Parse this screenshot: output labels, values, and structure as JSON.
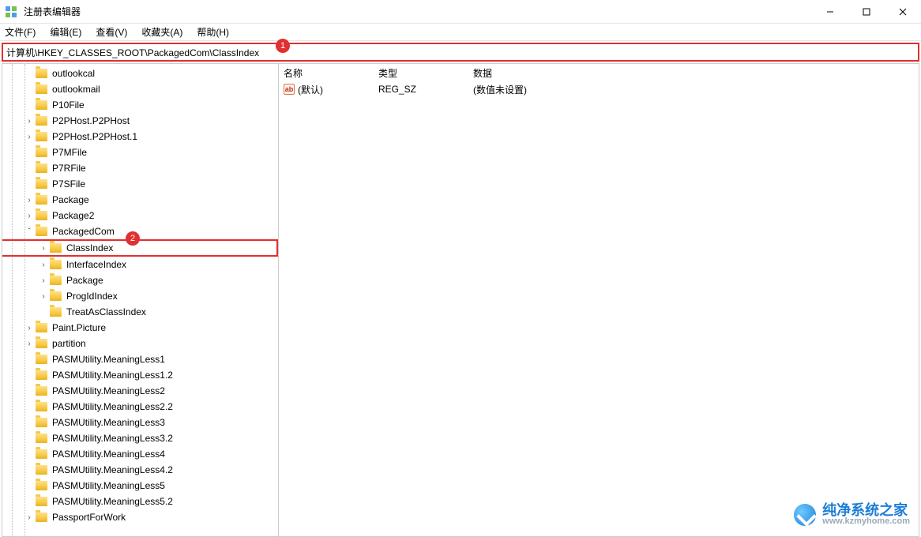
{
  "title": "注册表编辑器",
  "menu": {
    "file": "文件(F)",
    "edit": "编辑(E)",
    "view": "查看(V)",
    "fav": "收藏夹(A)",
    "help": "帮助(H)"
  },
  "address": "计算机\\HKEY_CLASSES_ROOT\\PackagedCom\\ClassIndex",
  "callouts": {
    "one": "1",
    "two": "2"
  },
  "columns": {
    "name": "名称",
    "type": "类型",
    "data": "数据"
  },
  "values": [
    {
      "name": "(默认)",
      "type": "REG_SZ",
      "data": "(数值未设置)"
    }
  ],
  "tree": [
    {
      "indent": 42,
      "exp": "",
      "label": "outlookcal"
    },
    {
      "indent": 42,
      "exp": "",
      "label": "outlookmail"
    },
    {
      "indent": 42,
      "exp": "",
      "label": "P10File"
    },
    {
      "indent": 42,
      "exp": ">",
      "label": "P2PHost.P2PHost"
    },
    {
      "indent": 42,
      "exp": ">",
      "label": "P2PHost.P2PHost.1"
    },
    {
      "indent": 42,
      "exp": "",
      "label": "P7MFile"
    },
    {
      "indent": 42,
      "exp": "",
      "label": "P7RFile"
    },
    {
      "indent": 42,
      "exp": "",
      "label": "P7SFile"
    },
    {
      "indent": 42,
      "exp": ">",
      "label": "Package"
    },
    {
      "indent": 42,
      "exp": ">",
      "label": "Package2"
    },
    {
      "indent": 42,
      "exp": "v",
      "label": "PackagedCom"
    },
    {
      "indent": 60,
      "exp": ">",
      "label": "ClassIndex",
      "selected": true
    },
    {
      "indent": 60,
      "exp": ">",
      "label": "InterfaceIndex"
    },
    {
      "indent": 60,
      "exp": ">",
      "label": "Package"
    },
    {
      "indent": 60,
      "exp": ">",
      "label": "ProgIdIndex"
    },
    {
      "indent": 60,
      "exp": "",
      "label": "TreatAsClassIndex"
    },
    {
      "indent": 42,
      "exp": ">",
      "label": "Paint.Picture"
    },
    {
      "indent": 42,
      "exp": ">",
      "label": "partition"
    },
    {
      "indent": 42,
      "exp": "",
      "label": "PASMUtility.MeaningLess1"
    },
    {
      "indent": 42,
      "exp": "",
      "label": "PASMUtility.MeaningLess1.2"
    },
    {
      "indent": 42,
      "exp": "",
      "label": "PASMUtility.MeaningLess2"
    },
    {
      "indent": 42,
      "exp": "",
      "label": "PASMUtility.MeaningLess2.2"
    },
    {
      "indent": 42,
      "exp": "",
      "label": "PASMUtility.MeaningLess3"
    },
    {
      "indent": 42,
      "exp": "",
      "label": "PASMUtility.MeaningLess3.2"
    },
    {
      "indent": 42,
      "exp": "",
      "label": "PASMUtility.MeaningLess4"
    },
    {
      "indent": 42,
      "exp": "",
      "label": "PASMUtility.MeaningLess4.2"
    },
    {
      "indent": 42,
      "exp": "",
      "label": "PASMUtility.MeaningLess5"
    },
    {
      "indent": 42,
      "exp": "",
      "label": "PASMUtility.MeaningLess5.2"
    },
    {
      "indent": 42,
      "exp": ">",
      "label": "PassportForWork"
    }
  ],
  "watermark": {
    "top": "纯净系统之家",
    "bottom": "www.kzmyhome.com"
  }
}
